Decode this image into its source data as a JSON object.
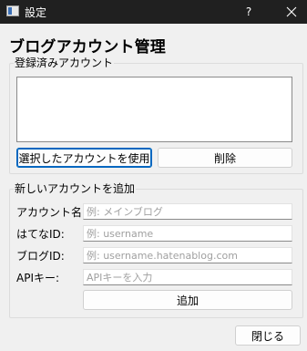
{
  "window": {
    "title": "設定",
    "help_label": "?"
  },
  "page_title": "ブログアカウント管理",
  "registered": {
    "group_title": "登録済みアカウント",
    "items": [],
    "use_button": "選択したアカウントを使用",
    "delete_button": "削除"
  },
  "new_account": {
    "group_title": "新しいアカウントを追加",
    "fields": [
      {
        "label": "アカウント名:",
        "placeholder": "例: メインブログ",
        "value": ""
      },
      {
        "label": "はてなID:",
        "placeholder": "例: username",
        "value": ""
      },
      {
        "label": "ブログID:",
        "placeholder": "例: username.hatenablog.com",
        "value": ""
      },
      {
        "label": "APIキー:",
        "placeholder": "APIキーを入力",
        "value": ""
      }
    ],
    "add_button": "追加"
  },
  "close_button": "閉じる",
  "colors": {
    "titlebar": "#202020",
    "background": "#f0f0f0",
    "focus_border": "#0067c0"
  },
  "icons": {
    "app": "window-icon",
    "close": "close-icon"
  }
}
